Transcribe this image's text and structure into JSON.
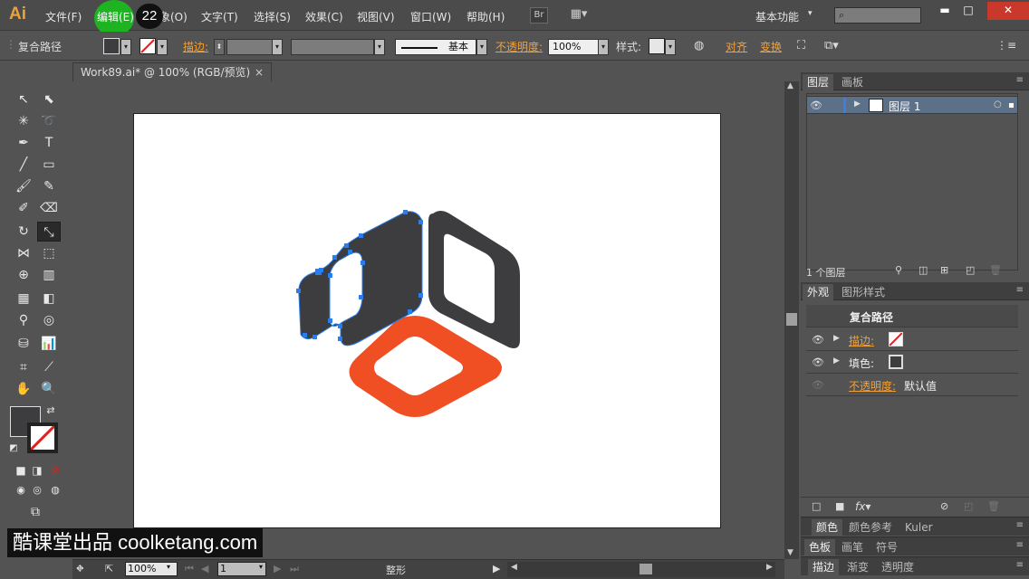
{
  "menubar": {
    "logo": "Ai",
    "menus": [
      "文件(F)",
      "编辑(E)",
      "对象(O)",
      "文字(T)",
      "选择(S)",
      "效果(C)",
      "视图(V)",
      "窗口(W)",
      "帮助(H)"
    ],
    "menu_visible_partial": "象(O)",
    "click_number": "22",
    "bridge_label": "Br",
    "workspace": "基本功能",
    "search_placeholder": ""
  },
  "controlbar": {
    "selection_type": "复合路径",
    "stroke_label": "描边:",
    "stroke_style": "基本",
    "opacity_label": "不透明度:",
    "opacity_value": "100%",
    "style_label": "样式:",
    "align_label": "对齐",
    "transform_label": "变换"
  },
  "document": {
    "tab_title": "Work89.ai* @ 100% (RGB/预览)",
    "close": "×"
  },
  "statusbar": {
    "zoom": "100%",
    "page": "1",
    "tool_name": "整形"
  },
  "layers_panel": {
    "tabs": [
      "图层",
      "画板"
    ],
    "layers": [
      {
        "name": "图层 1"
      }
    ],
    "count_text": "1 个图层"
  },
  "appearance_panel": {
    "tabs": [
      "外观",
      "图形样式"
    ],
    "title": "复合路径",
    "rows": [
      {
        "label": "描边:",
        "type": "stroke"
      },
      {
        "label": "填色:",
        "type": "fill"
      },
      {
        "label": "不透明度:",
        "value": "默认值"
      }
    ]
  },
  "collapsed_panels": [
    [
      "颜色",
      "颜色参考",
      "Kuler"
    ],
    [
      "色板",
      "画笔",
      "符号"
    ],
    [
      "描边",
      "渐变",
      "透明度"
    ]
  ],
  "watermark": "酷课堂出品 coolketang.com",
  "colors": {
    "orange_shape": "#f04e23",
    "dark_shape": "#3d3d3f",
    "selection_blue": "#2b7de9"
  }
}
